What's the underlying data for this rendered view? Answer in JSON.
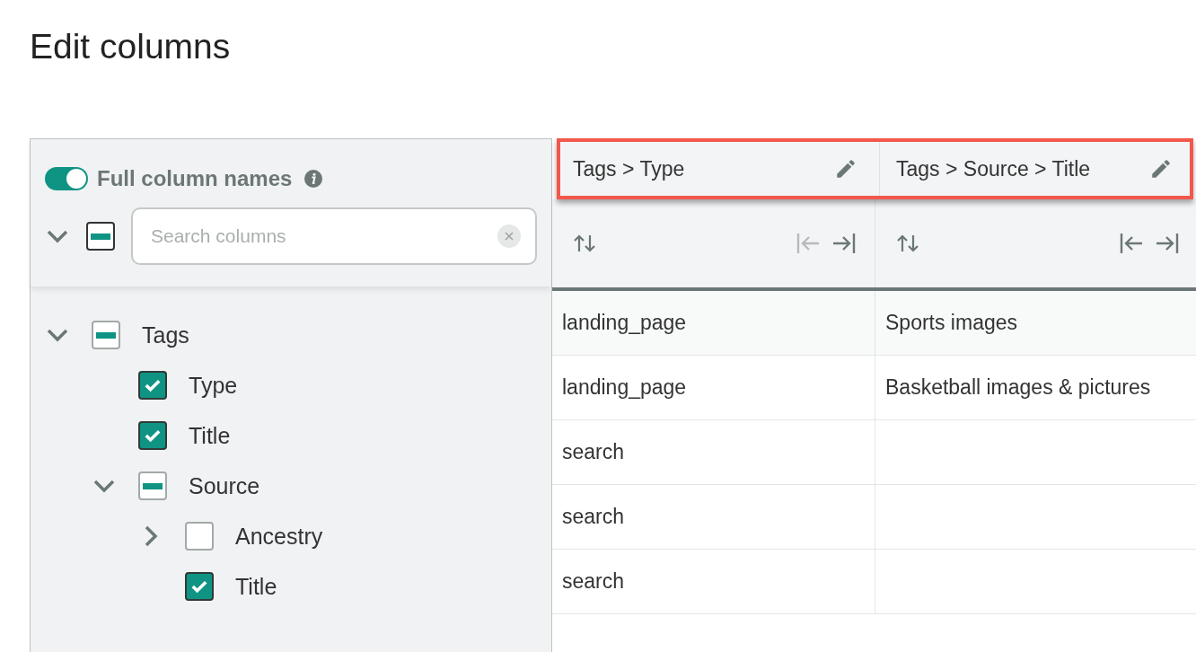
{
  "page_title": "Edit columns",
  "column_picker": {
    "full_names_toggle": {
      "label": "Full column names",
      "on": true
    },
    "tree_expanded": true,
    "select_all": {
      "partial": true
    },
    "search": {
      "placeholder": "Search columns"
    },
    "tree": [
      {
        "label": "Tags",
        "kind": "group",
        "expanded": true,
        "partial": true,
        "children": [
          {
            "label": "Type",
            "kind": "leaf",
            "checked": true
          },
          {
            "label": "Title",
            "kind": "leaf",
            "checked": true
          },
          {
            "label": "Source",
            "kind": "group",
            "expanded": true,
            "partial": true,
            "children": [
              {
                "label": "Ancestry",
                "kind": "group",
                "expanded": false,
                "checked": false
              },
              {
                "label": "Title",
                "kind": "leaf",
                "checked": true
              }
            ]
          }
        ]
      }
    ]
  },
  "table": {
    "header_highlighted": true,
    "columns": [
      {
        "name": "Tags > Type",
        "move_left_disabled": true,
        "move_right_disabled": false
      },
      {
        "name": "Tags > Source > Title",
        "move_left_disabled": false,
        "move_right_disabled": false
      }
    ],
    "rows": [
      [
        "landing_page",
        "Sports images"
      ],
      [
        "landing_page",
        "Basketball images & pictures"
      ],
      [
        "search",
        ""
      ],
      [
        "search",
        ""
      ],
      [
        "search",
        ""
      ]
    ]
  }
}
